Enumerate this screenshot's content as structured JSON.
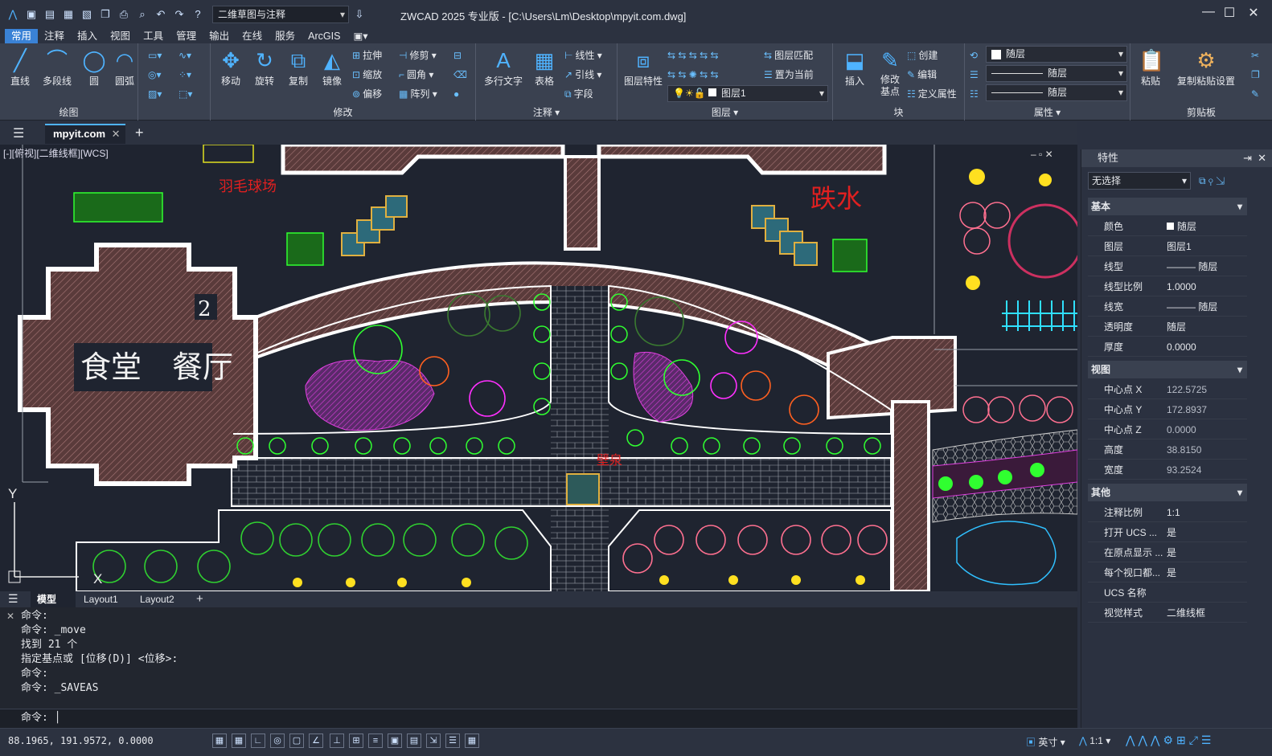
{
  "titlebar": {
    "workspace": "二维草图与注释",
    "title": "ZWCAD 2025 专业版 - [C:\\Users\\Lm\\Desktop\\mpyit.com.dwg]"
  },
  "menu": [
    "常用",
    "注释",
    "插入",
    "视图",
    "工具",
    "管理",
    "输出",
    "在线",
    "服务",
    "ArcGIS"
  ],
  "ribbon": {
    "draw": {
      "label": "绘图",
      "buttons": [
        "直线",
        "多段线",
        "圆",
        "圆弧"
      ]
    },
    "modify": {
      "label": "修改",
      "big": [
        "移动",
        "旋转",
        "复制",
        "镜像"
      ],
      "small": [
        "拉伸",
        "缩放",
        "偏移",
        "修剪",
        "圆角",
        "阵列"
      ]
    },
    "annotate": {
      "label": "注释",
      "big": [
        "多行文字",
        "表格"
      ],
      "small": [
        "线性",
        "引线",
        "字段"
      ]
    },
    "layers": {
      "label": "图层",
      "big": "图层特性",
      "small": [
        "图层匹配",
        "置为当前"
      ],
      "layer": "图层1"
    },
    "block": {
      "label": "块",
      "big": [
        "插入",
        "修改\n基点"
      ],
      "small": [
        "创建",
        "编辑",
        "定义属性"
      ]
    },
    "properties": {
      "label": "属性",
      "color": "随层",
      "linetype": "随层",
      "lineweight": "随层"
    },
    "clipboard": {
      "label": "剪贴板",
      "big": [
        "粘贴",
        "复制粘贴设置"
      ]
    }
  },
  "doc": {
    "tab": "mpyit.com",
    "view": "[-][俯视][二维线框][WCS]"
  },
  "drawing": {
    "labels": {
      "badminton": "羽毛球场",
      "water": "跌水",
      "canteen": "食堂　餐厅",
      "num": "2",
      "wall": "壁泉"
    },
    "axis_y": "Y",
    "axis_x": "X"
  },
  "layouts": [
    "模型",
    "Layout1",
    "Layout2"
  ],
  "command": {
    "lines": [
      "命令:",
      "命令: _move",
      "找到 21 个",
      "指定基点或 [位移(D)] <位移>:",
      "命令:",
      "命令: _SAVEAS"
    ],
    "prompt": "命令:"
  },
  "status": {
    "coords": "88.1965, 191.9572, 0.0000",
    "unit": "英寸",
    "scale": "1:1"
  },
  "props": {
    "title": "特性",
    "selection": "无选择",
    "sections": {
      "basic": "基本",
      "view": "视图",
      "other": "其他"
    },
    "basic": [
      [
        "颜色",
        "随层"
      ],
      [
        "图层",
        "图层1"
      ],
      [
        "线型",
        "——— 随层"
      ],
      [
        "线型比例",
        "1.0000"
      ],
      [
        "线宽",
        "——— 随层"
      ],
      [
        "透明度",
        "随层"
      ],
      [
        "厚度",
        "0.0000"
      ]
    ],
    "view": [
      [
        "中心点 X",
        "122.5725"
      ],
      [
        "中心点 Y",
        "172.8937"
      ],
      [
        "中心点 Z",
        "0.0000"
      ],
      [
        "高度",
        "38.8150"
      ],
      [
        "宽度",
        "93.2524"
      ]
    ],
    "other": [
      [
        "注释比例",
        "1:1"
      ],
      [
        "打开 UCS ...",
        "是"
      ],
      [
        "在原点显示 ...",
        "是"
      ],
      [
        "每个视口都...",
        "是"
      ],
      [
        "UCS 名称",
        ""
      ],
      [
        "视觉样式",
        "二维线框"
      ]
    ]
  }
}
